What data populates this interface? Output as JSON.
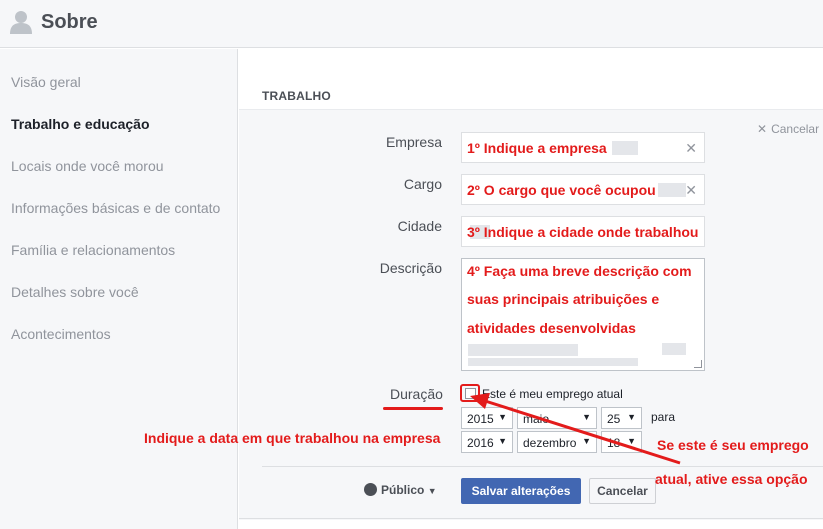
{
  "header": {
    "title": "Sobre",
    "icon": "person-icon"
  },
  "sidebar": {
    "items": [
      {
        "label": "Visão geral",
        "active": false
      },
      {
        "label": "Trabalho e educação",
        "active": true
      },
      {
        "label": "Locais onde você morou",
        "active": false
      },
      {
        "label": "Informações básicas e de contato",
        "active": false
      },
      {
        "label": "Família e relacionamentos",
        "active": false
      },
      {
        "label": "Detalhes sobre você",
        "active": false
      },
      {
        "label": "Acontecimentos",
        "active": false
      }
    ]
  },
  "work": {
    "section_title": "TRABALHO",
    "cancel_top": "Cancelar",
    "fields": {
      "empresa": {
        "label": "Empresa"
      },
      "cargo": {
        "label": "Cargo"
      },
      "cidade": {
        "label": "Cidade"
      },
      "descricao": {
        "label": "Descrição"
      }
    },
    "duration": {
      "label": "Duração",
      "current_job_label": "Este é meu emprego atual",
      "current_job_checked": false,
      "start": {
        "year": "2015",
        "month": "maio",
        "day": "25"
      },
      "to_label": "para",
      "end": {
        "year": "2016",
        "month": "dezembro",
        "day": "18"
      }
    },
    "privacy_label": "Público",
    "save_label": "Salvar alterações",
    "cancel_label": "Cancelar"
  },
  "annotations": {
    "empresa": "1º Indique a empresa",
    "cargo": "2º O cargo que você ocupou",
    "cidade": "3º Indique a cidade onde trabalhou",
    "descricao": [
      "4º Faça uma breve descrição com",
      "suas principais atribuições e",
      "atividades desenvolvidas"
    ],
    "data": "Indique a data em que trabalhou na empresa",
    "atual": [
      "Se este é seu emprego",
      "atual, ative essa opção"
    ],
    "color": "#e31b1b"
  }
}
